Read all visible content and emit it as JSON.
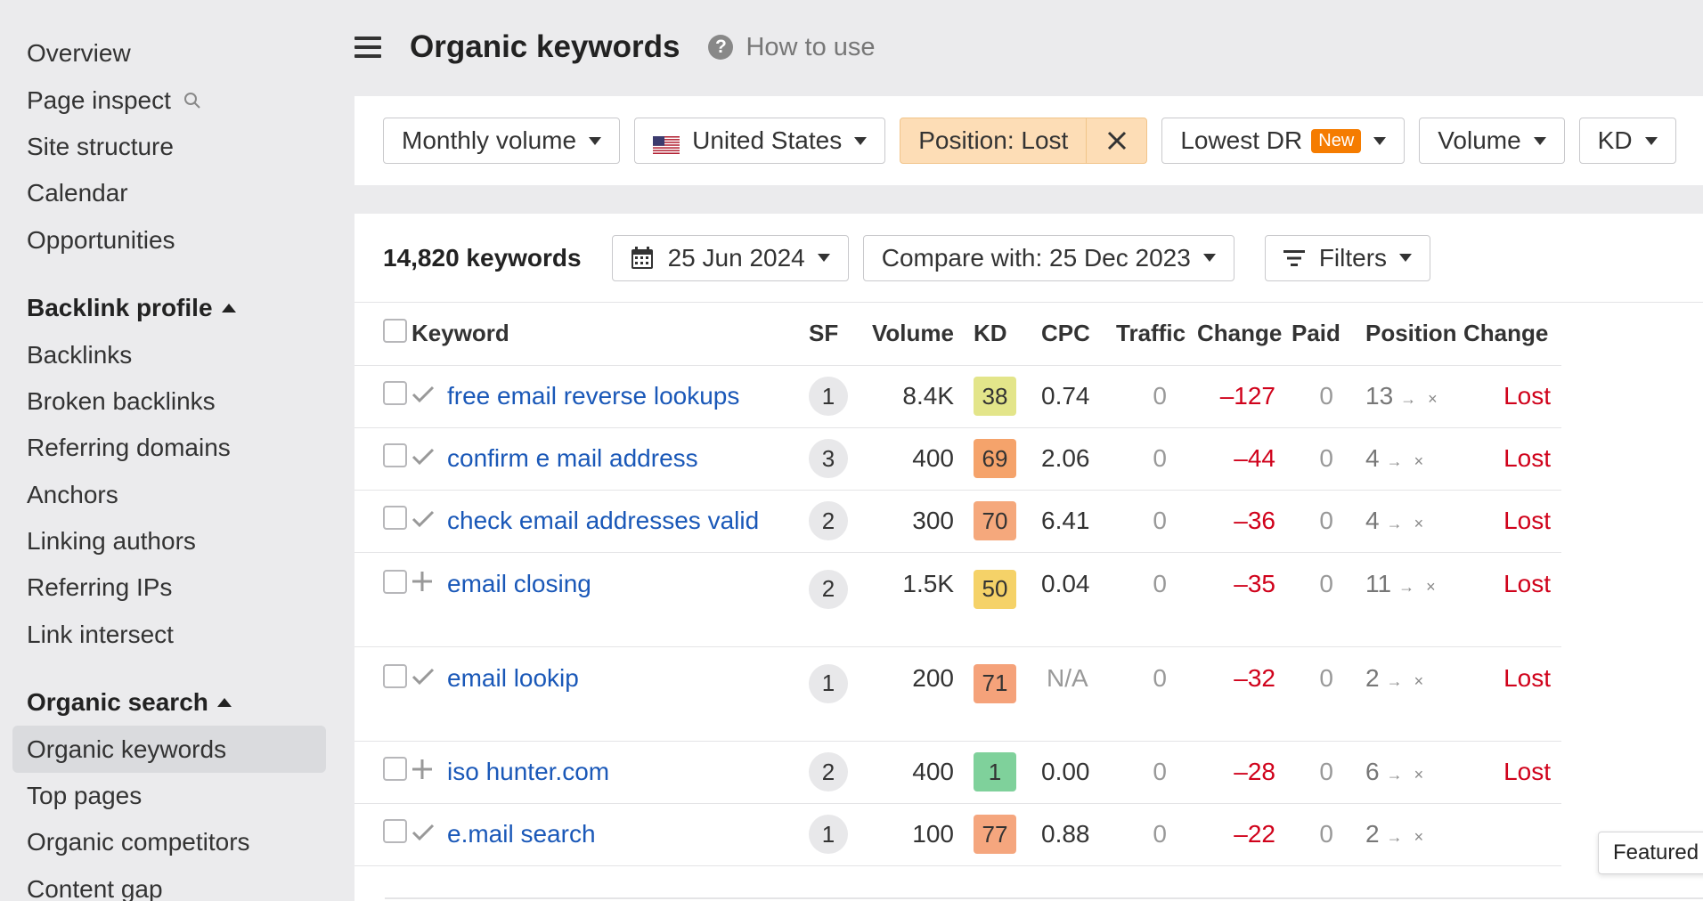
{
  "sidebar": {
    "items_top": [
      {
        "label": "Overview"
      },
      {
        "label": "Page inspect"
      },
      {
        "label": "Site structure"
      },
      {
        "label": "Calendar"
      },
      {
        "label": "Opportunities"
      }
    ],
    "backlink_section": {
      "label": "Backlink profile"
    },
    "backlink_items": [
      {
        "label": "Backlinks"
      },
      {
        "label": "Broken backlinks"
      },
      {
        "label": "Referring domains"
      },
      {
        "label": "Anchors"
      },
      {
        "label": "Linking authors"
      },
      {
        "label": "Referring IPs"
      },
      {
        "label": "Link intersect"
      }
    ],
    "organic_section": {
      "label": "Organic search"
    },
    "organic_items": [
      {
        "label": "Organic keywords",
        "active": true
      },
      {
        "label": "Top pages"
      },
      {
        "label": "Organic competitors"
      },
      {
        "label": "Content gap"
      }
    ]
  },
  "header": {
    "title": "Organic keywords",
    "how_to_use": "How to use"
  },
  "filters": {
    "monthly_volume": "Monthly volume",
    "country": "United States",
    "position": "Position: Lost",
    "lowest_dr": "Lowest DR",
    "new_badge": "New",
    "volume": "Volume",
    "kd": "KD"
  },
  "toolbar": {
    "keyword_count": "14,820 keywords",
    "date": "25 Jun 2024",
    "compare": "Compare with: 25 Dec 2023",
    "filters": "Filters"
  },
  "table": {
    "headers": {
      "keyword": "Keyword",
      "sf": "SF",
      "volume": "Volume",
      "kd": "KD",
      "cpc": "CPC",
      "traffic": "Traffic",
      "change": "Change",
      "paid": "Paid",
      "position": "Position",
      "change2": "Change"
    },
    "rows": [
      {
        "icon": "check",
        "keyword": "free email reverse lookups",
        "sf": "1",
        "volume": "8.4K",
        "kd": "38",
        "kd_color": "#e3e58a",
        "cpc": "0.74",
        "traffic": "0",
        "change": "–127",
        "paid": "0",
        "position": "13",
        "change2": "Lost",
        "tall": false
      },
      {
        "icon": "check",
        "keyword": "confirm e mail address",
        "sf": "3",
        "volume": "400",
        "kd": "69",
        "kd_color": "#f5a36b",
        "cpc": "2.06",
        "traffic": "0",
        "change": "–44",
        "paid": "0",
        "position": "4",
        "change2": "Lost",
        "tall": false
      },
      {
        "icon": "check",
        "keyword": "check email addresses valid",
        "sf": "2",
        "volume": "300",
        "kd": "70",
        "kd_color": "#f5a87c",
        "cpc": "6.41",
        "traffic": "0",
        "change": "–36",
        "paid": "0",
        "position": "4",
        "change2": "Lost",
        "tall": false
      },
      {
        "icon": "plus",
        "keyword": "email closing",
        "sf": "2",
        "volume": "1.5K",
        "kd": "50",
        "kd_color": "#f5d268",
        "cpc": "0.04",
        "traffic": "0",
        "change": "–35",
        "paid": "0",
        "position": "11",
        "change2": "Lost",
        "tall": true
      },
      {
        "icon": "check",
        "keyword": "email lookip",
        "sf": "1",
        "volume": "200",
        "kd": "71",
        "kd_color": "#f5a27a",
        "cpc": "N/A",
        "traffic": "0",
        "change": "–32",
        "paid": "0",
        "position": "2",
        "change2": "Lost",
        "tall": true
      },
      {
        "icon": "plus",
        "keyword": "iso hunter.com",
        "sf": "2",
        "volume": "400",
        "kd": "1",
        "kd_color": "#7fd19b",
        "cpc": "0.00",
        "traffic": "0",
        "change": "–28",
        "paid": "0",
        "position": "6",
        "change2": "Lost",
        "tall": false
      },
      {
        "icon": "check",
        "keyword": "e.mail search",
        "sf": "1",
        "volume": "100",
        "kd": "77",
        "kd_color": "#f5a67e",
        "cpc": "0.88",
        "traffic": "0",
        "change": "–22",
        "paid": "0",
        "position": "2",
        "change2": "",
        "tall": false
      }
    ]
  },
  "tooltip": {
    "label": "Featured"
  }
}
